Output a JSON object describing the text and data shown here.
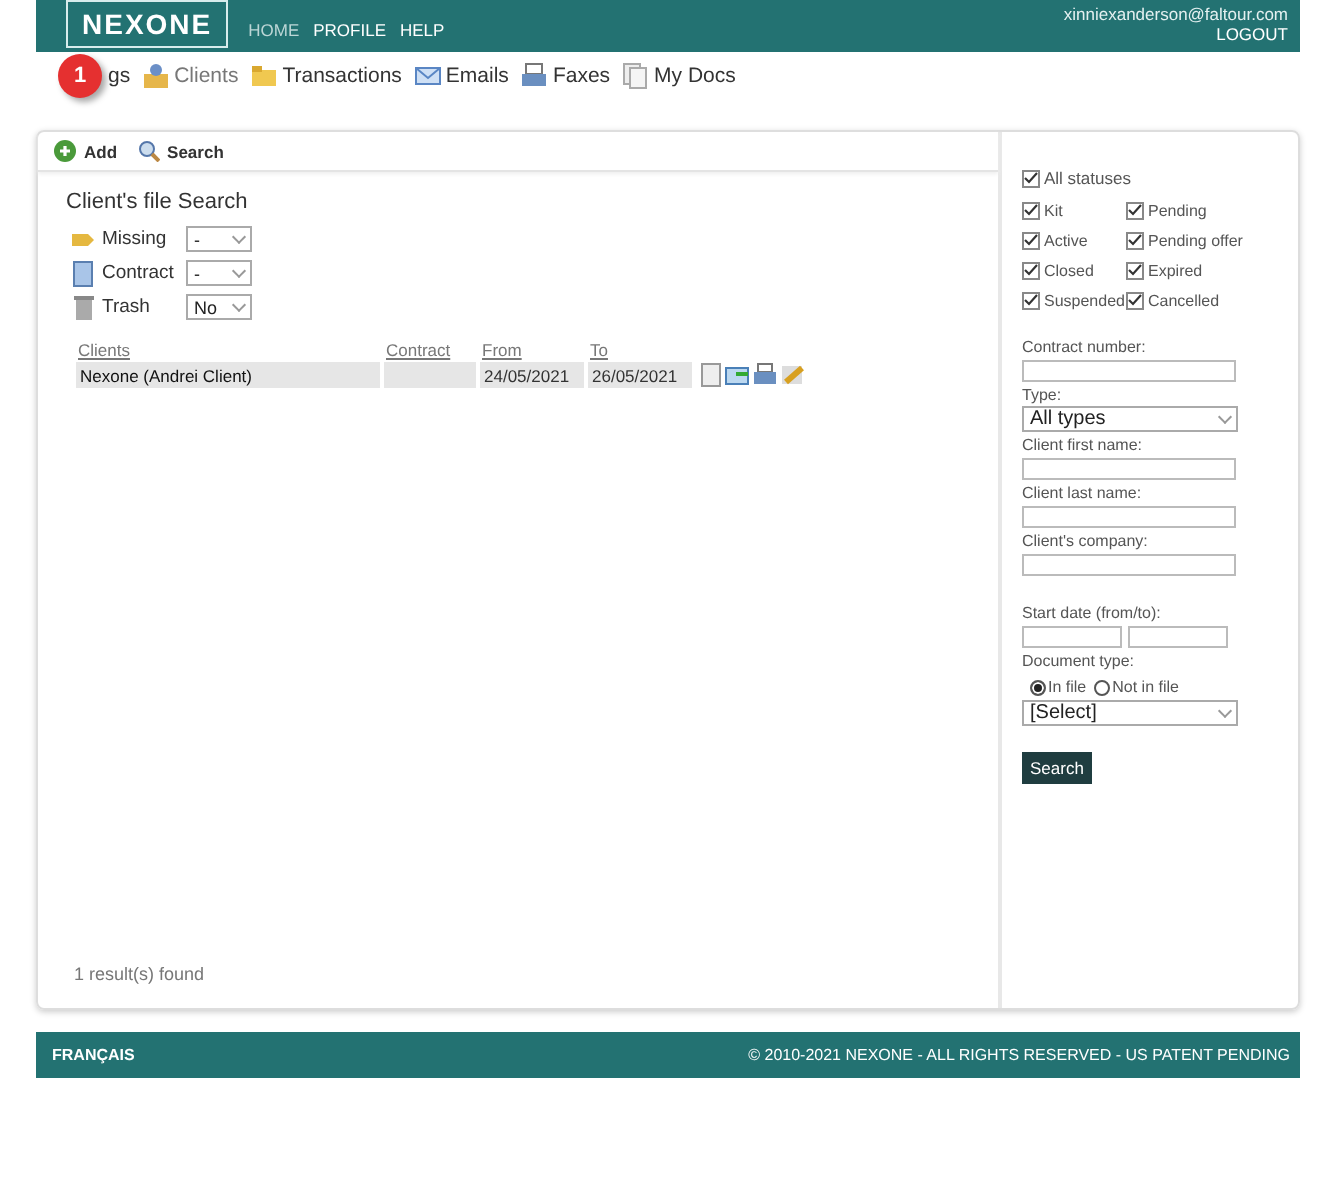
{
  "header": {
    "logo": "NEXONE",
    "menu": [
      {
        "label": "HOME",
        "selected": true
      },
      {
        "label": "PROFILE",
        "selected": false
      },
      {
        "label": "HELP",
        "selected": false
      }
    ],
    "user": "xinniexanderson@faltour.com",
    "logout": "LOGOUT"
  },
  "nav": [
    {
      "label": "gs"
    },
    {
      "label": "Clients"
    },
    {
      "label": "Transactions"
    },
    {
      "label": "Emails"
    },
    {
      "label": "Faxes"
    },
    {
      "label": "My Docs"
    }
  ],
  "callout": {
    "text": "1"
  },
  "toolbar": [
    {
      "label": "Add"
    },
    {
      "label": "Search"
    }
  ],
  "title": "Client's file Search",
  "filters": [
    {
      "label": "Missing",
      "value": "-"
    },
    {
      "label": "Contract",
      "value": "-"
    },
    {
      "label": "Trash",
      "value": "No"
    }
  ],
  "table": {
    "columns": [
      "Clients",
      "Contract",
      "From",
      "To"
    ],
    "rows": [
      {
        "cells": [
          "Nexone (Andrei Client)",
          "",
          "24/05/2021",
          "26/05/2021"
        ]
      }
    ]
  },
  "results": "1 result(s) found",
  "statuses": {
    "all": {
      "label": "All statuses",
      "checked": true
    },
    "items": [
      {
        "label": "Kit",
        "checked": true
      },
      {
        "label": "Pending",
        "checked": true
      },
      {
        "label": "Active",
        "checked": true
      },
      {
        "label": "Pending offer",
        "checked": true
      },
      {
        "label": "Closed",
        "checked": true
      },
      {
        "label": "Expired",
        "checked": true
      },
      {
        "label": "Suspended",
        "checked": true
      },
      {
        "label": "Cancelled",
        "checked": true
      }
    ]
  },
  "search_fields": [
    {
      "kind": "text",
      "label": "Contract number:"
    },
    {
      "kind": "select",
      "label": "Type:",
      "value": "All types"
    },
    {
      "kind": "text",
      "label": "Client first name:"
    },
    {
      "kind": "text",
      "label": "Client last name:"
    },
    {
      "kind": "text",
      "label": "Client's company:"
    },
    {
      "kind": "gap"
    },
    {
      "kind": "range",
      "label": "Start date (from/to):"
    },
    {
      "kind": "radio",
      "label": "Document type:",
      "options": [
        {
          "label": "In file",
          "selected": true
        },
        {
          "label": "Not in file",
          "selected": false
        }
      ]
    },
    {
      "kind": "select",
      "value": "[Select]"
    }
  ],
  "search_button": "Search",
  "footer": {
    "language": "FRANÇAIS",
    "copyright": "© 2010-2021 NEXONE - ALL RIGHTS RESERVED - US PATENT PENDING"
  }
}
